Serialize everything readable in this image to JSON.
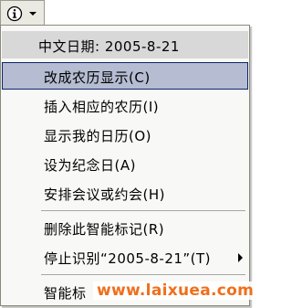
{
  "smart_tag": {
    "icon": "info-icon",
    "arrow": "chevron-down-icon"
  },
  "menu": {
    "header": "中文日期:  2005-8-21",
    "items": [
      {
        "label": "改成农历显示(C)",
        "highlighted": true
      },
      {
        "label": "插入相应的农历(I)"
      },
      {
        "label": "显示我的日历(O)"
      },
      {
        "label": "设为纪念日(A)"
      },
      {
        "label": "安排会议或约会(H)"
      },
      {
        "label": "删除此智能标记(R)"
      },
      {
        "label": "停止识别“2005-8-21”(T)"
      },
      {
        "label": "智能标"
      }
    ]
  },
  "watermark": "www.laixuea.com",
  "colors": {
    "highlight": "#b6bdd2",
    "highlight_border": "#0a246a",
    "watermark": "#ef6f1c"
  }
}
